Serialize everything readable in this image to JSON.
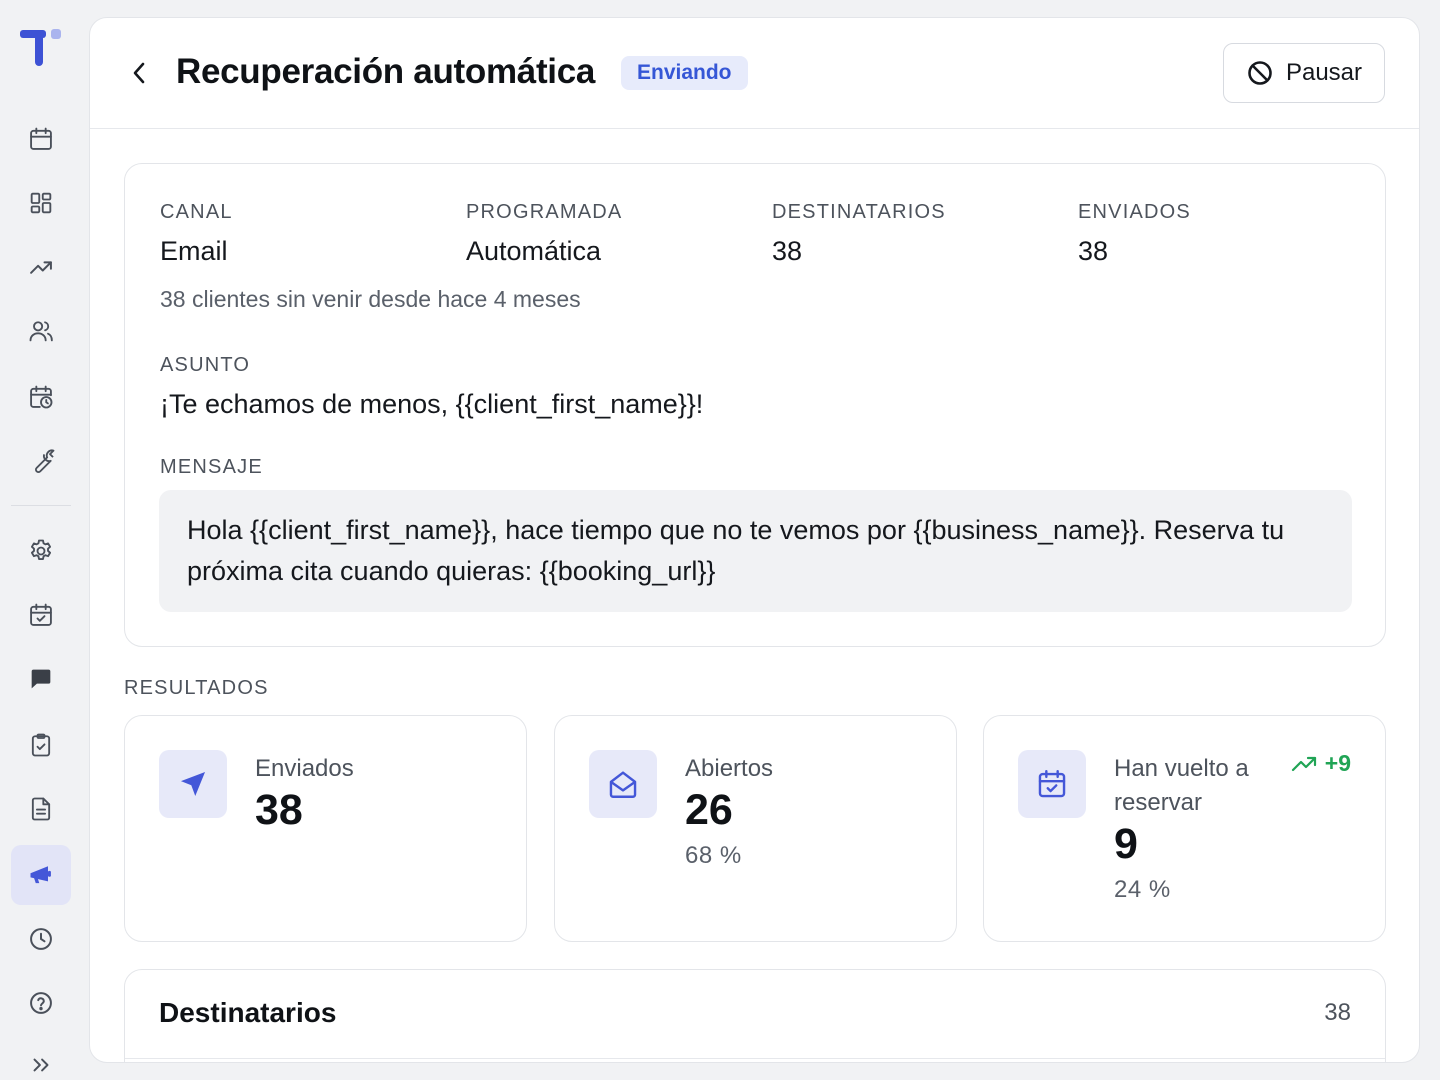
{
  "sidebar": {
    "items": [
      {
        "icon": "calendar-icon"
      },
      {
        "icon": "dashboard-grid-icon"
      },
      {
        "icon": "trending-up-icon"
      },
      {
        "icon": "users-icon"
      },
      {
        "icon": "calendar-clock-icon"
      },
      {
        "icon": "wrench-icon"
      },
      {
        "icon": "settings-gear-icon"
      },
      {
        "icon": "calendar-check-icon"
      },
      {
        "icon": "message-bubble-icon"
      },
      {
        "icon": "clipboard-check-icon"
      },
      {
        "icon": "document-icon"
      },
      {
        "icon": "megaphone-icon",
        "active": true
      },
      {
        "icon": "clock-icon"
      },
      {
        "icon": "help-circle-icon"
      }
    ],
    "accent_color": "#4457d8"
  },
  "header": {
    "title": "Recuperación automática",
    "status": "Enviando",
    "pause_label": "Pausar"
  },
  "details": {
    "channel_label": "CANAL",
    "channel_value": "Email",
    "scheduled_label": "PROGRAMADA",
    "scheduled_value": "Automática",
    "recipients_label": "DESTINATARIOS",
    "recipients_value": "38",
    "sent_label": "ENVIADOS",
    "sent_value": "38",
    "audience": "38 clientes sin venir desde hace 4 meses",
    "subject_label": "ASUNTO",
    "subject": "¡Te echamos de menos, {{client_first_name}}!",
    "message_label": "MENSAJE",
    "message": "Hola {{client_first_name}}, hace tiempo que no te vemos por {{business_name}}. Reserva tu próxima cita cuando quieras: {{booking_url}}"
  },
  "results": {
    "label": "RESULTADOS",
    "sent": {
      "label": "Enviados",
      "value": "38"
    },
    "opened": {
      "label": "Abiertos",
      "value": "26",
      "percent": "68 %"
    },
    "rebooked": {
      "label": "Han vuelto a reservar",
      "value": "9",
      "percent": "24 %",
      "trend": "+9"
    },
    "trend_color": "#20a455"
  },
  "recipients": {
    "title": "Destinatarios",
    "count": "38"
  }
}
